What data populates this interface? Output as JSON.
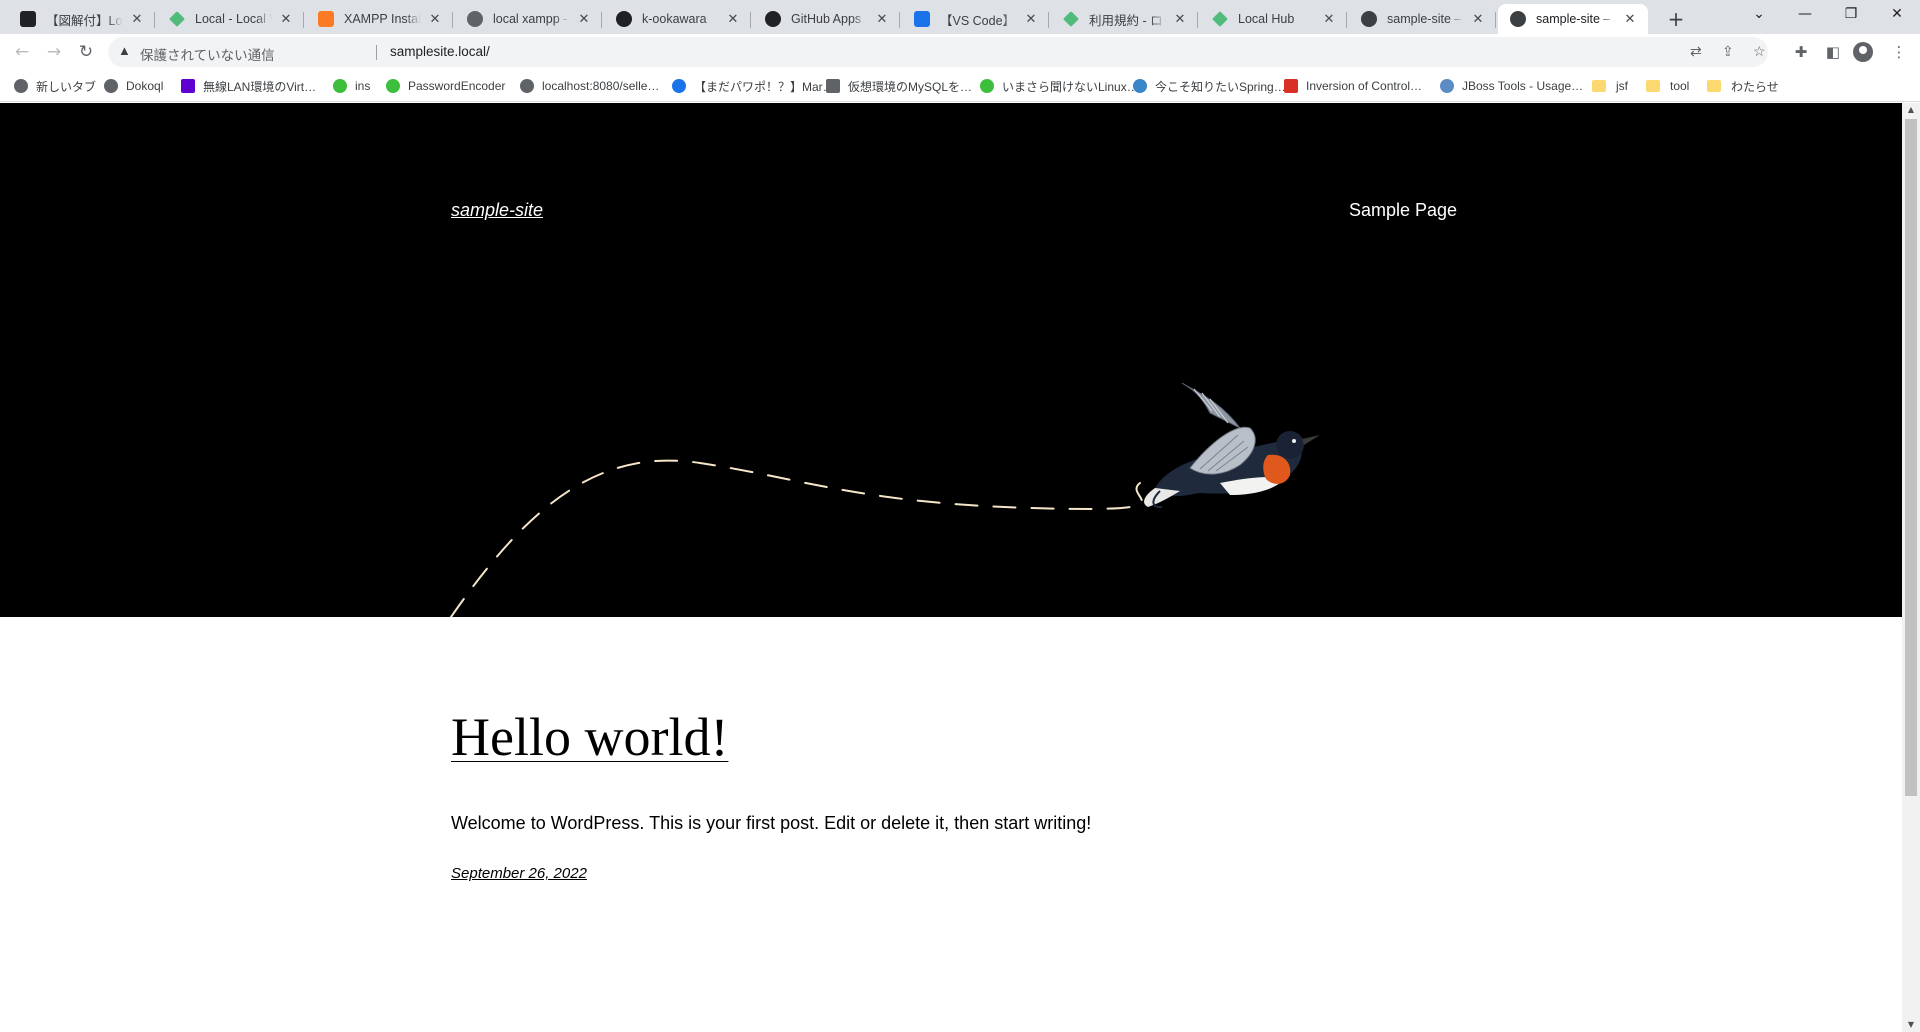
{
  "browser": {
    "tabs": [
      {
        "title": "【図解付】Local('…",
        "favicon": "bird-icon",
        "color": "#202124"
      },
      {
        "title": "Local - Local Wo…",
        "favicon": "local-diamond-icon",
        "color": "#51bb7b"
      },
      {
        "title": "XAMPP Installer…",
        "favicon": "xampp-icon",
        "color": "#fb7a24"
      },
      {
        "title": "local xampp - G…",
        "favicon": "globe-icon",
        "color": "#5f6368"
      },
      {
        "title": "k-ookawara",
        "favicon": "github-icon",
        "color": "#202124"
      },
      {
        "title": "GitHub Apps",
        "favicon": "github-icon",
        "color": "#202124"
      },
      {
        "title": "【VS Code】マーク…",
        "favicon": "qiita-icon",
        "color": "#1a73e8"
      },
      {
        "title": "利用規約 - ローカ…",
        "favicon": "local-diamond-icon",
        "color": "#51bb7b"
      },
      {
        "title": "Local Hub",
        "favicon": "local-diamond-icon",
        "color": "#51bb7b"
      },
      {
        "title": "sample-site – Ju…",
        "favicon": "wordpress-icon",
        "color": "#3c4043"
      },
      {
        "title": "sample-site – Ju…",
        "favicon": "wordpress-icon",
        "color": "#3c4043"
      }
    ],
    "new_tab_label": "+",
    "security_text": "保護されていない通信",
    "url": "samplesite.local/",
    "bookmarks": [
      {
        "label": "新しいタブ",
        "icon": "globe-icon",
        "color": "#5f6368"
      },
      {
        "label": "Dokoql",
        "icon": "globe-icon",
        "color": "#5f6368"
      },
      {
        "label": "無線LAN環境のVirt…",
        "icon": "yahoo-icon",
        "color": "#5f01d1"
      },
      {
        "label": "ins",
        "icon": "green-circle-icon",
        "color": "#3dbe3c"
      },
      {
        "label": "PasswordEncoder",
        "icon": "green-circle-icon",
        "color": "#3dbe3c"
      },
      {
        "label": "localhost:8080/selle…",
        "icon": "globe-icon",
        "color": "#5f6368"
      },
      {
        "label": "【まだパワポ！？】Mar…",
        "icon": "swirl-icon",
        "color": "#1a73e8"
      },
      {
        "label": "仮想環境のMySQLを…",
        "icon": "cube-icon",
        "color": "#5f6368"
      },
      {
        "label": "いまさら聞けないLinux…",
        "icon": "green-circle-icon",
        "color": "#3dbe3c"
      },
      {
        "label": "今こそ知りたいSpring…",
        "icon": "bird-blue-icon",
        "color": "#3a86c8"
      },
      {
        "label": "Inversion of Control…",
        "icon": "red-square-icon",
        "color": "#d93025"
      },
      {
        "label": "JBoss Tools - Usage…",
        "icon": "gear-blue-icon",
        "color": "#5b8cc6"
      },
      {
        "label": "jsf",
        "icon": "folder-icon",
        "color": "#fbd870"
      },
      {
        "label": "tool",
        "icon": "folder-icon",
        "color": "#fbd870"
      },
      {
        "label": "わたらせ",
        "icon": "folder-icon",
        "color": "#fbd870"
      }
    ]
  },
  "site": {
    "title": "sample-site",
    "nav_item": "Sample Page",
    "post": {
      "title": "Hello world!",
      "excerpt": "Welcome to WordPress. This is your first post. Edit or delete it, then start writing!",
      "date": "September 26, 2022"
    }
  },
  "colors": {
    "hero_background": "#000000",
    "dash_line": "#f5e6c8",
    "bird_breast": "#e0581c"
  }
}
